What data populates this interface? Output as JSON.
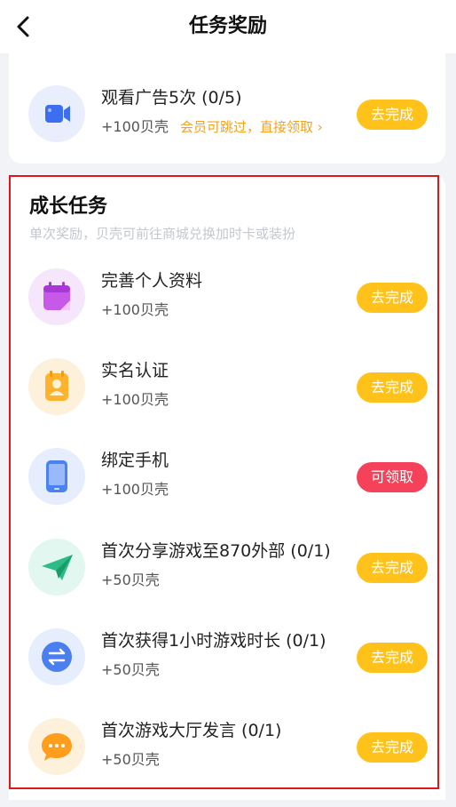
{
  "header": {
    "title": "任务奖励"
  },
  "top_task": {
    "title": "观看广告5次 (0/5)",
    "reward": "+100贝壳",
    "note": "会员可跳过，直接领取 ›",
    "button": "去完成"
  },
  "growth": {
    "title": "成长任务",
    "subtitle": "单次奖励，贝壳可前往商城兑换加时卡或装扮",
    "tasks": [
      {
        "icon": "calendar-icon",
        "title": "完善个人资料",
        "reward": "+100贝壳",
        "button": "去完成"
      },
      {
        "icon": "id-card-icon",
        "title": "实名认证",
        "reward": "+100贝壳",
        "button": "去完成"
      },
      {
        "icon": "phone-icon",
        "title": "绑定手机",
        "reward": "+100贝壳",
        "button": "可领取"
      },
      {
        "icon": "paper-plane-icon",
        "title": "首次分享游戏至870外部 (0/1)",
        "reward": "+50贝壳",
        "button": "去完成"
      },
      {
        "icon": "exchange-icon",
        "title": "首次获得1小时游戏时长 (0/1)",
        "reward": "+50贝壳",
        "button": "去完成"
      },
      {
        "icon": "chat-bubble-icon",
        "title": "首次游戏大厅发言 (0/1)",
        "reward": "+50贝壳",
        "button": "去完成"
      }
    ]
  },
  "colors": {
    "action_button": "#ffc21a",
    "claim_button": "#f5425a",
    "note_text": "#f4a21c",
    "highlight": "#e0161b"
  }
}
